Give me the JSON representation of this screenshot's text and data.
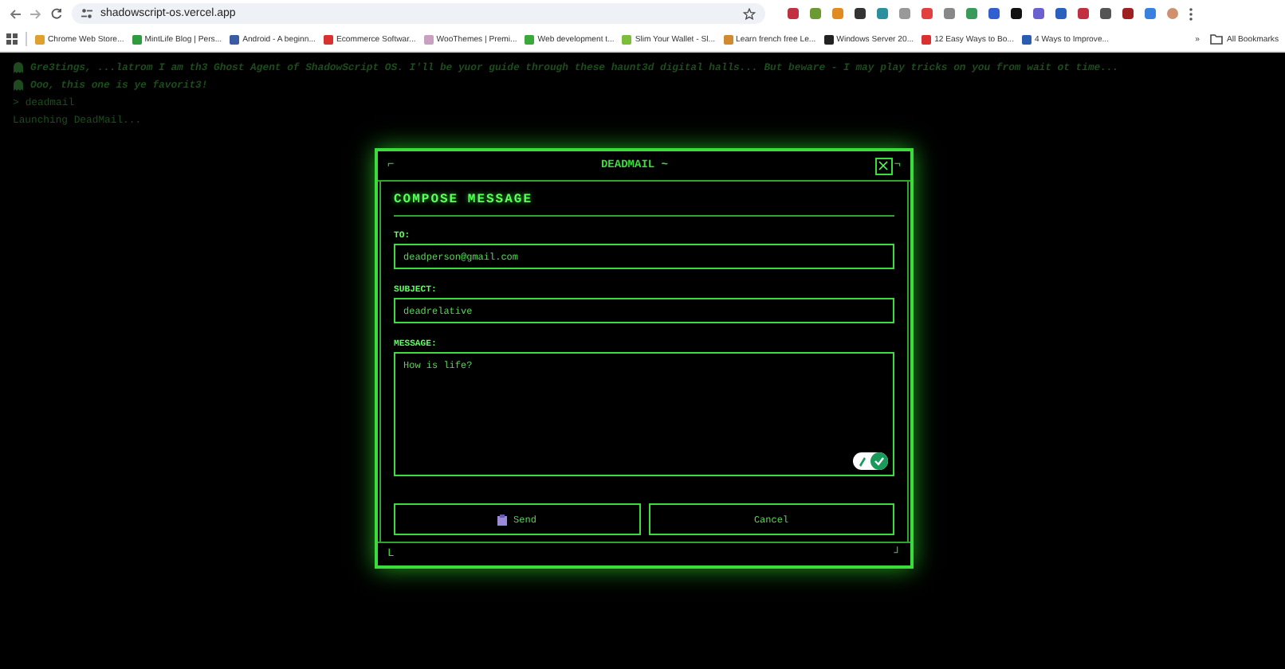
{
  "browser": {
    "url": "shadowscript-os.vercel.app",
    "bookmarks": [
      {
        "label": "Chrome Web Store...",
        "color": "#e0a030"
      },
      {
        "label": "MintLife Blog | Pers...",
        "color": "#2e9b3e"
      },
      {
        "label": "Android - A beginn...",
        "color": "#3b5ba5"
      },
      {
        "label": "Ecommerce Softwar...",
        "color": "#d93030"
      },
      {
        "label": "WooThemes | Premi...",
        "color": "#c9a0c0"
      },
      {
        "label": "Web development t...",
        "color": "#3aa83a"
      },
      {
        "label": "Slim Your Wallet - Sl...",
        "color": "#7cbd3a"
      },
      {
        "label": "Learn french free Le...",
        "color": "#d08a30"
      },
      {
        "label": "Windows Server 20...",
        "color": "#222222"
      },
      {
        "label": "12 Easy Ways to Bo...",
        "color": "#d93030"
      },
      {
        "label": "4 Ways to Improve...",
        "color": "#2a5db0"
      }
    ],
    "more": "»",
    "all_bookmarks": "All Bookmarks"
  },
  "terminal": {
    "lines": [
      {
        "kind": "ghost",
        "text": "Gre3tings, ...latrom I am th3 Ghost Agent of ShadowScript OS. I'll be yuor guide through these haunt3d digital halls... But beware - I may play tricks on you from wait ot time..."
      },
      {
        "kind": "ghost",
        "text": "Ooo, this one is ye favorit3!"
      },
      {
        "kind": "command",
        "prompt": ">",
        "text": "deadmail"
      },
      {
        "kind": "output",
        "text": "Launching DeadMail..."
      }
    ]
  },
  "dialog": {
    "title": "DEADMAIL ~",
    "corner_top_left": "⌐",
    "corner_top_right": "¬",
    "corner_bottom_left": "L",
    "corner_bottom_right": "┘",
    "heading": "COMPOSE MESSAGE",
    "to": {
      "label": "TO:",
      "value": "deadperson@gmail.com"
    },
    "subject": {
      "label": "SUBJECT:",
      "value": "deadrelative"
    },
    "message": {
      "label": "MESSAGE:",
      "value": "How is life?"
    },
    "buttons": [
      {
        "kind": "send",
        "label": "Send"
      },
      {
        "kind": "cancel",
        "label": "Cancel"
      }
    ]
  }
}
